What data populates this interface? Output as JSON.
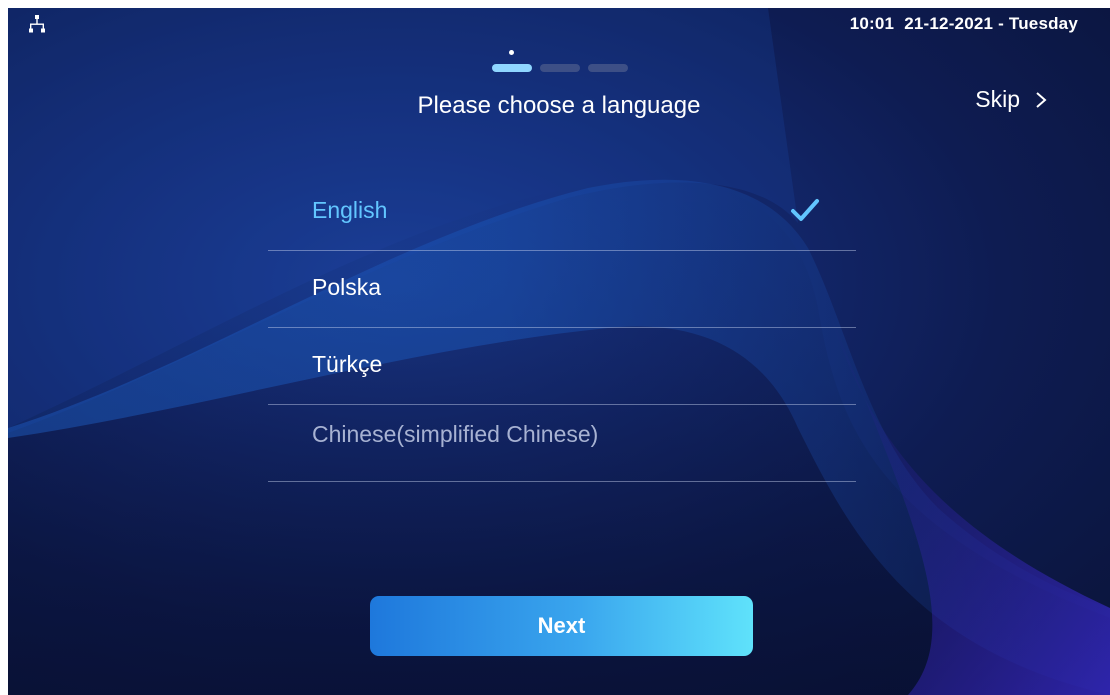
{
  "status_bar": {
    "network_icon": "network-icon",
    "time": "10:01",
    "date": "21-12-2021 - Tuesday"
  },
  "wizard": {
    "steps_total": 3,
    "current_step": 1,
    "title": "Please choose a language",
    "skip_label": "Skip",
    "next_label": "Next"
  },
  "languages": [
    {
      "label": "English",
      "selected": true
    },
    {
      "label": "Polska",
      "selected": false
    },
    {
      "label": "Türkçe",
      "selected": false
    },
    {
      "label": "Chinese(simplified Chinese)",
      "selected": false
    }
  ],
  "colors": {
    "accent": "#62c6ff",
    "background": "#0e1c52",
    "button_gradient_start": "#1e78dc",
    "button_gradient_end": "#5fe2fb"
  }
}
